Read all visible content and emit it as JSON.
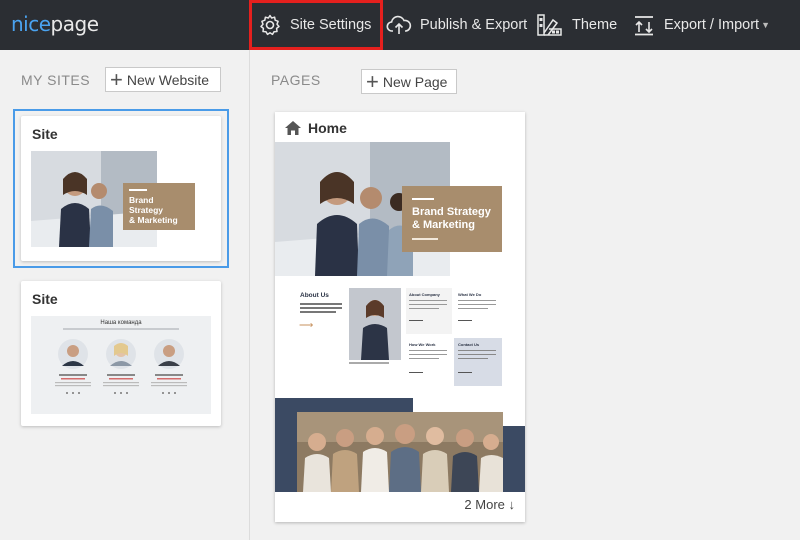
{
  "topbar": {
    "logo_part1": "nice",
    "logo_part2": "page",
    "site_settings": "Site Settings",
    "publish_export": "Publish & Export",
    "theme": "Theme",
    "export_import": "Export / Import"
  },
  "left": {
    "section_title": "MY SITES",
    "new_website": "New Website",
    "sites": [
      {
        "title": "Site",
        "banner_l1": "Brand Strategy",
        "banner_l2": "& Marketing"
      },
      {
        "title": "Site",
        "heading": "Наша команда"
      }
    ]
  },
  "right": {
    "section_title": "PAGES",
    "new_page": "New Page",
    "page": {
      "title": "Home",
      "banner_l1": "Brand Strategy",
      "banner_l2": "& Marketing",
      "about": "About Us",
      "cells": [
        "About Company",
        "What We Do",
        "How We Work",
        "Contact Us"
      ],
      "more": "2 More ↓"
    }
  },
  "colors": {
    "topbar_bg": "#2b2e33",
    "accent_blue": "#4a9be8",
    "highlight_red": "#e5201e",
    "tan": "#a88d6d",
    "navy": "#3b4a63"
  }
}
